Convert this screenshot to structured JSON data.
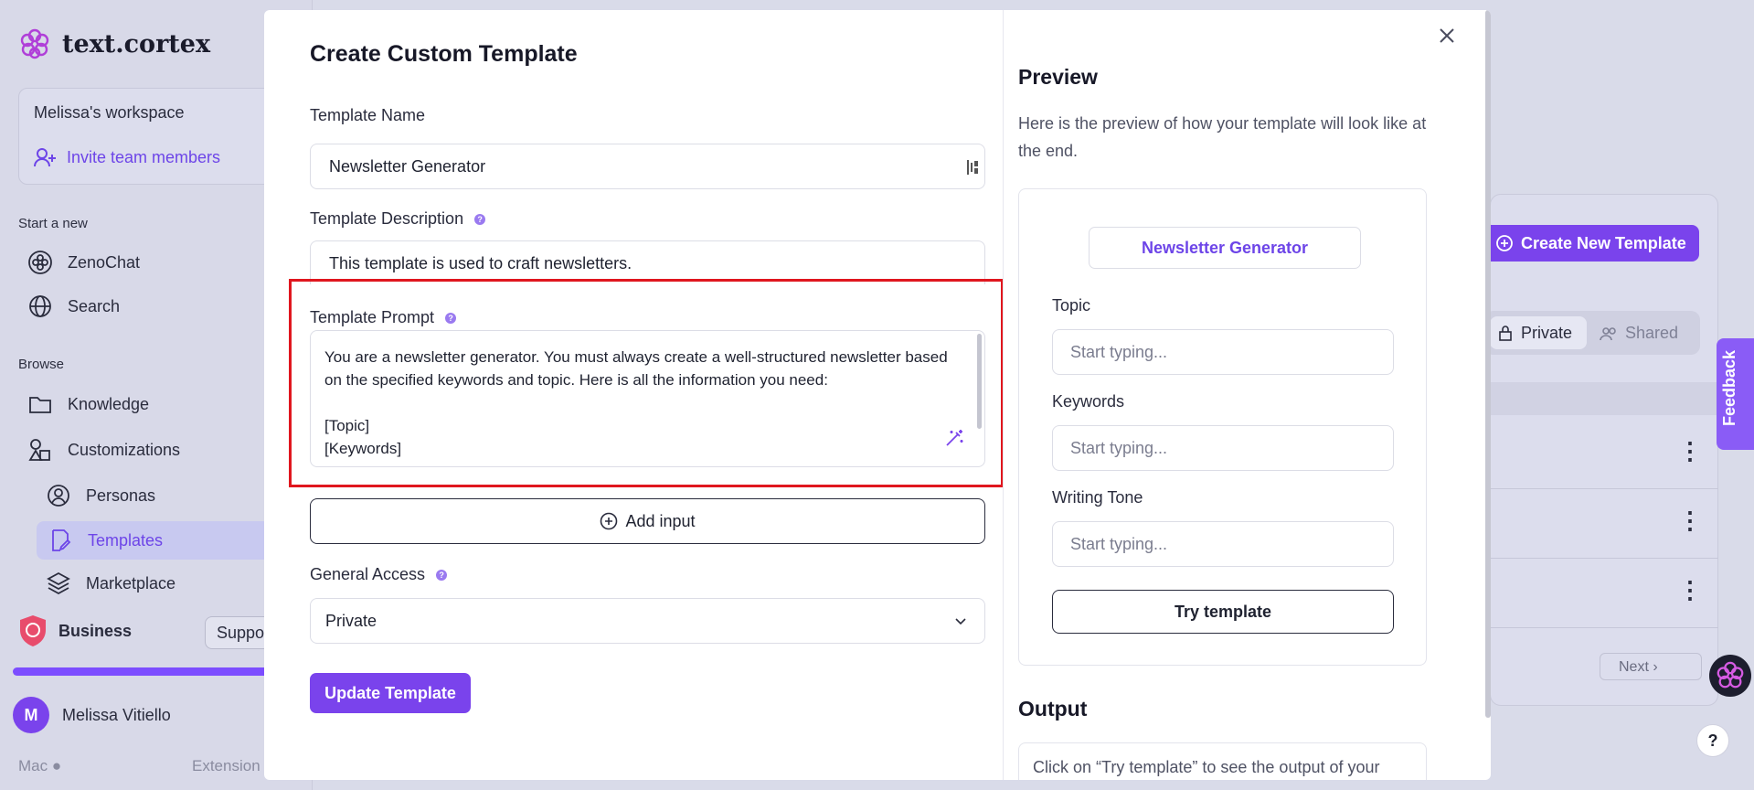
{
  "app": {
    "logo_text": "text.cortex"
  },
  "sidebar": {
    "workspace_name": "Melissa's workspace",
    "invite_label": "Invite team members",
    "start_new_label": "Start a new",
    "start_items": [
      {
        "label": "ZenoChat",
        "icon": "brain-icon"
      },
      {
        "label": "Search",
        "icon": "globe-icon"
      }
    ],
    "browse_label": "Browse",
    "browse_items": [
      {
        "label": "Knowledge",
        "icon": "folder-icon"
      },
      {
        "label": "Customizations",
        "icon": "shapes-icon"
      },
      {
        "label": "Personas",
        "icon": "user-circle-icon"
      },
      {
        "label": "Templates",
        "icon": "edit-document-icon",
        "active": true
      },
      {
        "label": "Marketplace",
        "icon": "layers-icon"
      }
    ],
    "plan_label": "Business",
    "support_label": "Support",
    "progress_fraction": 1.0,
    "user_initial": "M",
    "user_name": "Melissa Vitiello",
    "os_label": "Mac",
    "extension_label": "Extension"
  },
  "background": {
    "create_new_label": "Create New Template",
    "private_tab": "Private",
    "shared_tab": "Shared",
    "next_label": "Next",
    "feedback_label": "Feedback",
    "help_label": "?"
  },
  "modal": {
    "title": "Create Custom Template",
    "name_label": "Template Name",
    "name_value": "Newsletter Generator",
    "description_label": "Template Description",
    "description_value": "This template is used to craft newsletters.",
    "prompt_label": "Template Prompt",
    "prompt_value": "You are a newsletter generator. You must always create a well-structured newsletter based on the specified keywords and topic. Here is all the information you need:\n\n[Topic]\n[Keywords]",
    "add_input_label": "Add input",
    "access_label": "General Access",
    "access_value": "Private",
    "update_label": "Update Template"
  },
  "preview": {
    "title": "Preview",
    "description": "Here is the preview of how your template will look like at the end.",
    "template_name": "Newsletter Generator",
    "fields": [
      {
        "label": "Topic",
        "placeholder": "Start typing..."
      },
      {
        "label": "Keywords",
        "placeholder": "Start typing..."
      },
      {
        "label": "Writing Tone",
        "placeholder": "Start typing..."
      }
    ],
    "try_label": "Try template",
    "output_title": "Output",
    "output_placeholder": "Click on “Try template” to see the output of your"
  },
  "colors": {
    "accent": "#7a43ec",
    "highlight": "#e0161e"
  }
}
